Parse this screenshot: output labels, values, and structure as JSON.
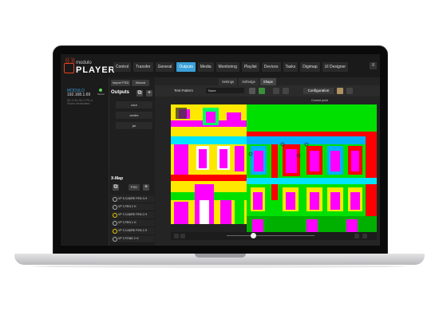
{
  "app": {
    "logo_small": "modulo",
    "logo_big": "PLAYER"
  },
  "menu": {
    "items": [
      "Control",
      "Transfer",
      "General",
      "Outputs",
      "Media",
      "Monitoring",
      "Playlist",
      "Devices",
      "Tasks",
      "Digimap",
      "UI Designer"
    ],
    "active": "Outputs",
    "more_icon": "menu-icon"
  },
  "device": {
    "name": "MODULO",
    "ip": "192.168.1.69",
    "sub1": "52.3.34.34.1 PK-o",
    "sub2": "Show dedicated",
    "status": "Master"
  },
  "outputs": {
    "import_label": "Import PSD",
    "wizard_label": "Wizard",
    "title": "Outputs",
    "items": [
      "cour",
      "centre",
      "jar"
    ]
  },
  "xmap": {
    "title": "X-Map",
    "psd_label": "PSD",
    "rows": [
      {
        "label": "VP 5 CADRE FEN 3 H",
        "ring": "grey"
      },
      {
        "label": "VP 3 FEN 2 H",
        "ring": "grey"
      },
      {
        "label": "VP 3 CADRE FEN 2 H",
        "ring": "yellow"
      },
      {
        "label": "VP 3 FEN 1 H",
        "ring": "grey"
      },
      {
        "label": "VP 3 CADRE FEN 1 H",
        "ring": "yellow"
      },
      {
        "label": "VP 3 FOND 2 H",
        "ring": "grey"
      }
    ]
  },
  "main": {
    "subtabs": [
      "Settings",
      "Softedge",
      "Shape"
    ],
    "active_subtab": "Shape",
    "test_pattern_label": "Test Pattern",
    "test_pattern_value": "None",
    "config_label": "Configuration",
    "current_point_label": "Current point"
  },
  "colors": {
    "accent": "#3aa0d8",
    "brand": "#e8401c"
  }
}
